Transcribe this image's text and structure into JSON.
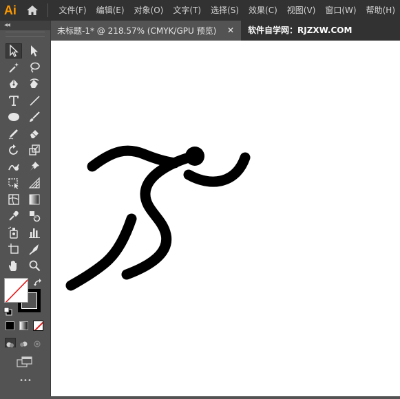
{
  "app": {
    "logo": "Ai"
  },
  "menu": [
    "文件(F)",
    "编辑(E)",
    "对象(O)",
    "文字(T)",
    "选择(S)",
    "效果(C)",
    "视图(V)",
    "窗口(W)",
    "帮助(H)"
  ],
  "tab": {
    "title": "未标题-1* @ 218.57% (CMYK/GPU 预览)",
    "close": "✕"
  },
  "site": "软件自学网：RJZXW.COM",
  "toolbar": {
    "collapse": "◂◂",
    "tools": [
      {
        "name": "selection-tool-icon",
        "glyph": "selection"
      },
      {
        "name": "direct-selection-tool-icon",
        "glyph": "direct"
      },
      {
        "name": "magic-wand-tool-icon",
        "glyph": "wand"
      },
      {
        "name": "lasso-tool-icon",
        "glyph": "lasso"
      },
      {
        "name": "pen-tool-icon",
        "glyph": "pen"
      },
      {
        "name": "curvature-tool-icon",
        "glyph": "curvature"
      },
      {
        "name": "type-tool-icon",
        "glyph": "T"
      },
      {
        "name": "line-segment-tool-icon",
        "glyph": "line"
      },
      {
        "name": "ellipse-tool-icon",
        "glyph": "ellipse"
      },
      {
        "name": "paintbrush-tool-icon",
        "glyph": "brush"
      },
      {
        "name": "pencil-tool-icon",
        "glyph": "pencil"
      },
      {
        "name": "eraser-tool-icon",
        "glyph": "eraser"
      },
      {
        "name": "rotate-tool-icon",
        "glyph": "rotate"
      },
      {
        "name": "scale-tool-icon",
        "glyph": "scale"
      },
      {
        "name": "warp-tool-icon",
        "glyph": "warp"
      },
      {
        "name": "puppet-warp-tool-icon",
        "glyph": "pin"
      },
      {
        "name": "free-transform-tool-icon",
        "glyph": "freetransform"
      },
      {
        "name": "perspective-grid-tool-icon",
        "glyph": "perspective"
      },
      {
        "name": "mesh-tool-icon",
        "glyph": "mesh"
      },
      {
        "name": "gradient-tool-icon",
        "glyph": "gradient"
      },
      {
        "name": "eyedropper-tool-icon",
        "glyph": "eyedropper"
      },
      {
        "name": "blend-tool-icon",
        "glyph": "blend"
      },
      {
        "name": "symbol-sprayer-tool-icon",
        "glyph": "sprayer"
      },
      {
        "name": "column-graph-tool-icon",
        "glyph": "graph"
      },
      {
        "name": "artboard-tool-icon",
        "glyph": "artboard"
      },
      {
        "name": "slice-tool-icon",
        "glyph": "slice"
      },
      {
        "name": "hand-tool-icon",
        "glyph": "hand"
      },
      {
        "name": "zoom-tool-icon",
        "glyph": "zoom"
      }
    ],
    "more": "•••"
  },
  "colors": {
    "menu_bg": "#323232",
    "panel_bg": "#535353",
    "logo": "#ff9a00",
    "canvas": "#ffffff",
    "fill": "#ffffff",
    "stroke": "#000000",
    "none_slash": "#e41b1b"
  }
}
